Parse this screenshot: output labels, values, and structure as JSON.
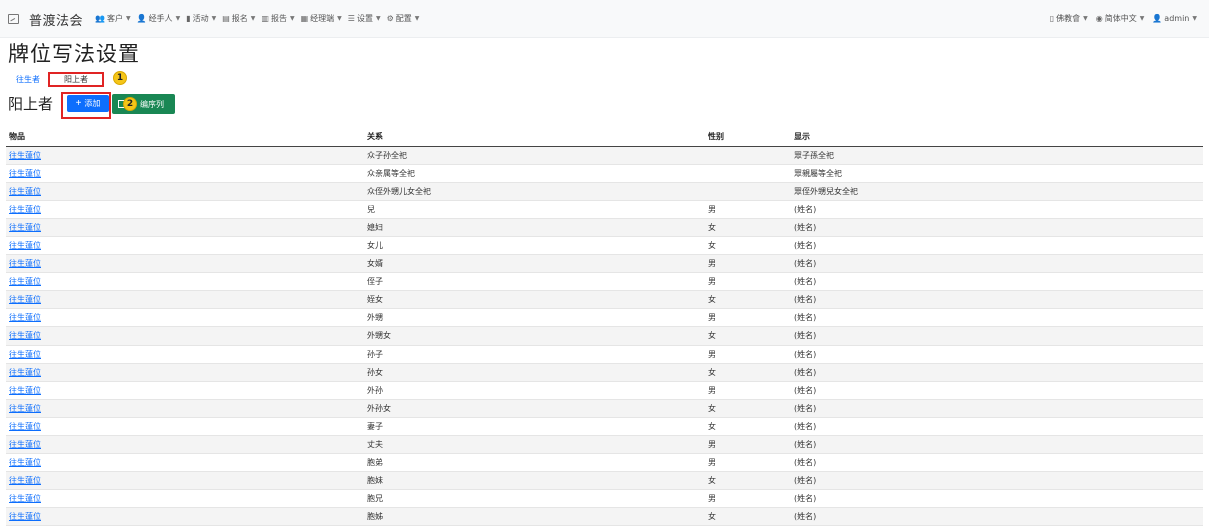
{
  "navbar": {
    "brand": "普渡法会",
    "menu": [
      {
        "icon": "users-icon",
        "glyph": "👥",
        "label": "客户"
      },
      {
        "icon": "user-icon",
        "glyph": "👤",
        "label": "经手人"
      },
      {
        "icon": "chart-icon",
        "glyph": "▮",
        "label": "活动"
      },
      {
        "icon": "clipboard-icon",
        "glyph": "▤",
        "label": "报名"
      },
      {
        "icon": "report-icon",
        "glyph": "▥",
        "label": "报告"
      },
      {
        "icon": "cash-register-icon",
        "glyph": "▦",
        "label": "经理端"
      },
      {
        "icon": "list-icon",
        "glyph": "☰",
        "label": "设置"
      },
      {
        "icon": "gear-icon",
        "glyph": "⚙",
        "label": "配置"
      }
    ],
    "right": [
      {
        "icon": "book-icon",
        "glyph": "▯",
        "label": "佛教會"
      },
      {
        "icon": "globe-icon",
        "glyph": "◉",
        "label": "简体中文"
      },
      {
        "icon": "user-icon",
        "glyph": "👤",
        "label": "admin"
      }
    ]
  },
  "page": {
    "title": "牌位写法设置",
    "tabs": [
      "往生者",
      "阳上者"
    ],
    "section_title": "阳上者",
    "add_label": "添加",
    "order_label": "编序列",
    "badge1": "1",
    "badge2": "2"
  },
  "table": {
    "headers": [
      "物品",
      "关系",
      "性别",
      "显示"
    ],
    "rows": [
      [
        "往生蓮位",
        "众子孙全祀",
        "",
        "眾子孫全祀"
      ],
      [
        "往生蓮位",
        "众亲属等全祀",
        "",
        "眾親屬等全祀"
      ],
      [
        "往生蓮位",
        "众侄外甥儿女全祀",
        "",
        "眾侄外甥兒女全祀"
      ],
      [
        "往生蓮位",
        "兒",
        "男",
        "(姓名)"
      ],
      [
        "往生蓮位",
        "媳妇",
        "女",
        "(姓名)"
      ],
      [
        "往生蓮位",
        "女儿",
        "女",
        "(姓名)"
      ],
      [
        "往生蓮位",
        "女婿",
        "男",
        "(姓名)"
      ],
      [
        "往生蓮位",
        "侄子",
        "男",
        "(姓名)"
      ],
      [
        "往生蓮位",
        "姪女",
        "女",
        "(姓名)"
      ],
      [
        "往生蓮位",
        "外甥",
        "男",
        "(姓名)"
      ],
      [
        "往生蓮位",
        "外甥女",
        "女",
        "(姓名)"
      ],
      [
        "往生蓮位",
        "孙子",
        "男",
        "(姓名)"
      ],
      [
        "往生蓮位",
        "孙女",
        "女",
        "(姓名)"
      ],
      [
        "往生蓮位",
        "外孙",
        "男",
        "(姓名)"
      ],
      [
        "往生蓮位",
        "外孙女",
        "女",
        "(姓名)"
      ],
      [
        "往生蓮位",
        "妻子",
        "女",
        "(姓名)"
      ],
      [
        "往生蓮位",
        "丈夫",
        "男",
        "(姓名)"
      ],
      [
        "往生蓮位",
        "胞弟",
        "男",
        "(姓名)"
      ],
      [
        "往生蓮位",
        "胞妹",
        "女",
        "(姓名)"
      ],
      [
        "往生蓮位",
        "胞兄",
        "男",
        "(姓名)"
      ],
      [
        "往生蓮位",
        "胞姊",
        "女",
        "(姓名)"
      ]
    ]
  }
}
